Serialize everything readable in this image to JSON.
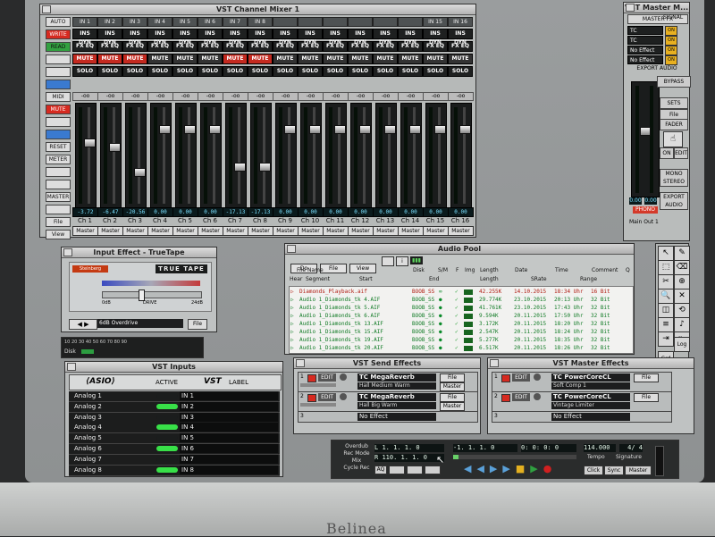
{
  "monitor": {
    "brand": "Belinea"
  },
  "mixer": {
    "title": "VST Channel Mixer 1",
    "controls": [
      "AUTO",
      "WRITE",
      "READ",
      "",
      "",
      "",
      "MIDI",
      "MUTE",
      "",
      "",
      "RESET",
      "METER",
      "",
      "",
      "MASTER",
      "",
      "File",
      "View"
    ],
    "channels": [
      {
        "in": "IN 1",
        "fx": "FX EQ",
        "ins": "INS DYN",
        "mute": "MUTE",
        "mute_on": true,
        "solo": "SOLO",
        "val": "-3.72",
        "name": "Ch 1",
        "out": "Master",
        "cap": 0.35
      },
      {
        "in": "IN 2",
        "fx": "FX EQ",
        "ins": "INS DYN",
        "mute": "MUTE",
        "mute_on": true,
        "solo": "SOLO",
        "val": "-6.47",
        "name": "Ch 2",
        "out": "Master",
        "cap": 0.4
      },
      {
        "in": "IN 3",
        "fx": "FX EQ",
        "ins": "INS DYN",
        "mute": "MUTE",
        "mute_on": true,
        "solo": "SOLO",
        "val": "-20.56",
        "name": "Ch 3",
        "out": "Master",
        "cap": 0.68
      },
      {
        "in": "IN 4",
        "fx": "FX EQ",
        "ins": "INS DYN",
        "mute": "MUTE",
        "mute_on": false,
        "solo": "SOLO",
        "val": "0.00",
        "name": "Ch 4",
        "out": "Master",
        "cap": 0.2
      },
      {
        "in": "IN 5",
        "fx": "FX EQ",
        "ins": "INS DYN",
        "mute": "MUTE",
        "mute_on": false,
        "solo": "SOLO",
        "val": "0.00",
        "name": "Ch 5",
        "out": "Master",
        "cap": 0.2
      },
      {
        "in": "IN 6",
        "fx": "FX EQ",
        "ins": "INS DYN",
        "mute": "MUTE",
        "mute_on": false,
        "solo": "SOLO",
        "val": "0.00",
        "name": "Ch 6",
        "out": "Master",
        "cap": 0.2
      },
      {
        "in": "IN 7",
        "fx": "FX EQ",
        "ins": "INS DYN",
        "mute": "MUTE",
        "mute_on": true,
        "solo": "SOLO",
        "val": "-17.13",
        "name": "Ch 7",
        "out": "Master",
        "cap": 0.62
      },
      {
        "in": "IN 8",
        "fx": "FX EQ",
        "ins": "INS DYN",
        "mute": "MUTE",
        "mute_on": true,
        "solo": "SOLO",
        "val": "-17.13",
        "name": "Ch 8",
        "out": "Master",
        "cap": 0.62
      },
      {
        "in": "",
        "fx": "FX EQ",
        "ins": "INS DYN",
        "mute": "MUTE",
        "mute_on": false,
        "solo": "SOLO",
        "val": "0.00",
        "name": "Ch 9",
        "out": "Master",
        "cap": 0.2
      },
      {
        "in": "",
        "fx": "FX EQ",
        "ins": "INS DYN",
        "mute": "MUTE",
        "mute_on": false,
        "solo": "SOLO",
        "val": "0.00",
        "name": "Ch 10",
        "out": "Master",
        "cap": 0.2
      },
      {
        "in": "",
        "fx": "FX EQ",
        "ins": "INS DYN",
        "mute": "MUTE",
        "mute_on": false,
        "solo": "SOLO",
        "val": "0.00",
        "name": "Ch 11",
        "out": "Master",
        "cap": 0.2
      },
      {
        "in": "",
        "fx": "FX EQ",
        "ins": "INS DYN",
        "mute": "MUTE",
        "mute_on": false,
        "solo": "SOLO",
        "val": "0.00",
        "name": "Ch 12",
        "out": "Master",
        "cap": 0.2
      },
      {
        "in": "",
        "fx": "FX EQ",
        "ins": "INS DYN",
        "mute": "MUTE",
        "mute_on": false,
        "solo": "SOLO",
        "val": "0.00",
        "name": "Ch 13",
        "out": "Master",
        "cap": 0.2
      },
      {
        "in": "",
        "fx": "FX EQ",
        "ins": "INS DYN",
        "mute": "MUTE",
        "mute_on": false,
        "solo": "SOLO",
        "val": "0.00",
        "name": "Ch 14",
        "out": "Master",
        "cap": 0.2
      },
      {
        "in": "IN 15",
        "fx": "FX EQ",
        "ins": "INS DYN",
        "mute": "MUTE",
        "mute_on": false,
        "solo": "SOLO",
        "val": "0.00",
        "name": "Ch 15",
        "out": "Master",
        "cap": 0.2
      },
      {
        "in": "IN 16",
        "fx": "FX EQ",
        "ins": "INS DYN",
        "mute": "MUTE",
        "mute_on": false,
        "solo": "SOLO",
        "val": "0.00",
        "name": "Ch 16",
        "out": "Master",
        "cap": 0.2
      }
    ]
  },
  "master": {
    "title": "VST Master M...",
    "fx_label": "MASTER FX",
    "signal_label": "SIGNAL",
    "slots": [
      "TC PowerCo..",
      "TC PowerCo..",
      "No Effect",
      "No Effect"
    ],
    "slot_state": [
      "ON",
      "ON",
      "ON",
      "ON"
    ],
    "export": "EXPORT AUDIO",
    "bypass": "BYPASS",
    "sets": "SETS",
    "file": "File",
    "fader": "FADER",
    "on": "ON",
    "edit": "EDIT",
    "mono_stereo": "MONO STEREO",
    "export_audio": "EXPORT AUDIO",
    "val_l": "0.00",
    "val_r": "0.00",
    "phono": "PHONO",
    "out": "Main Out 1"
  },
  "truetape": {
    "title": "Input Effect - TrueTape",
    "logo": "TRUE TAPE",
    "brand": "Steinberg",
    "label_l": "0dB",
    "label_c": "DRIVE",
    "label_r": "24dB",
    "preset": "6dB Overdrive",
    "file": "File"
  },
  "disk": {
    "label": "Disk",
    "scale": "10 20 30 40 50 60 70 80 90"
  },
  "pool": {
    "title": "Audio Pool",
    "menus": [
      "Do",
      "File",
      "View"
    ],
    "headers": {
      "file": "File Name",
      "disk": "Disk",
      "sm": "S/M",
      "f": "F",
      "img": "Img",
      "length": "Length",
      "date": "Date",
      "time": "Time",
      "comment": "Comment",
      "q": "Q"
    },
    "subheaders": {
      "hear": "Hear",
      "segment": "Segment",
      "start": "Start",
      "end": "End",
      "length": "Length",
      "srate": "SRate",
      "range": "Range"
    },
    "rows": [
      {
        "name": "Diamonds_Playback.aif",
        "disk": "BOOB_SS",
        "length": "42.255K",
        "date": "14.10.2015",
        "time": "18:34 Uhr",
        "comment": "16 Bit",
        "color": "#b01a10"
      },
      {
        "name": "Audio 1_Diamonds_tk 4.AIF",
        "disk": "BOOB_SS",
        "length": "29.774K",
        "date": "23.10.2015",
        "time": "20:13 Uhr",
        "comment": "32 Bit",
        "color": "#0f7a24"
      },
      {
        "name": "Audio 1_Diamonds_tk 5.AIF",
        "disk": "BOOB_SS",
        "length": "41.761K",
        "date": "23.10.2015",
        "time": "17:43 Uhr",
        "comment": "32 Bit",
        "color": "#0f7a24"
      },
      {
        "name": "Audio 1_Diamonds_tk 6.AIF",
        "disk": "BOOB_SS",
        "length": "9.594K",
        "date": "20.11.2015",
        "time": "17:50 Uhr",
        "comment": "32 Bit",
        "color": "#0f7a24"
      },
      {
        "name": "Audio 1_Diamonds_tk 13.AIF",
        "disk": "BOOB_SS",
        "length": "3.172K",
        "date": "20.11.2015",
        "time": "18:20 Uhr",
        "comment": "32 Bit",
        "color": "#0f7a24"
      },
      {
        "name": "Audio 1_Diamonds_tk 15.AIF",
        "disk": "BOOB_SS",
        "length": "2.547K",
        "date": "20.11.2015",
        "time": "18:24 Uhr",
        "comment": "32 Bit",
        "color": "#0f7a24"
      },
      {
        "name": "Audio 1_Diamonds_tk 19.AIF",
        "disk": "BOOB_SS",
        "length": "5.277K",
        "date": "20.11.2015",
        "time": "18:35 Uhr",
        "comment": "32 Bit",
        "color": "#0f7a24"
      },
      {
        "name": "Audio 1_Diamonds_tk 20.AIF",
        "disk": "BOOB_SS",
        "length": "6.517K",
        "date": "20.11.2015",
        "time": "18:26 Uhr",
        "comment": "32 Bit",
        "color": "#0f7a24"
      }
    ]
  },
  "toolbox": {
    "log": "Log",
    "grid": "Grd"
  },
  "inputs": {
    "title": "VST Inputs",
    "asio": "ASIO",
    "active": "ACTIVE",
    "label": "LABEL",
    "vst": "VST",
    "rows": [
      {
        "name": "Analog 1",
        "active": false,
        "in": "IN 1"
      },
      {
        "name": "Analog 2",
        "active": true,
        "in": "IN 2"
      },
      {
        "name": "Analog 3",
        "active": false,
        "in": "IN 3"
      },
      {
        "name": "Analog 4",
        "active": true,
        "in": "IN 4"
      },
      {
        "name": "Analog 5",
        "active": false,
        "in": "IN 5"
      },
      {
        "name": "Analog 6",
        "active": true,
        "in": "IN 6"
      },
      {
        "name": "Analog 7",
        "active": false,
        "in": "IN 7"
      },
      {
        "name": "Analog 8",
        "active": true,
        "in": "IN 8"
      }
    ]
  },
  "sendfx": {
    "title": "VST Send Effects",
    "slots": [
      {
        "n": "1",
        "edit": "EDIT",
        "name": "TC MegaReverb",
        "preset": "Hall Medium Warm",
        "file": "File",
        "out": "Master"
      },
      {
        "n": "2",
        "edit": "EDIT",
        "name": "TC MegaReverb",
        "preset": "Hall Big Warm",
        "file": "File",
        "out": "Master"
      },
      {
        "n": "3",
        "name": "No Effect"
      }
    ]
  },
  "masterfx": {
    "title": "VST Master Effects",
    "slots": [
      {
        "n": "1",
        "edit": "EDIT",
        "name": "TC PowerCoreCL",
        "preset": "Soft Comp 1",
        "file": "File"
      },
      {
        "n": "2",
        "edit": "EDIT",
        "name": "TC PowerCoreCL",
        "preset": "Vintage Limiter",
        "file": "File"
      },
      {
        "n": "3",
        "name": "No Effect"
      }
    ]
  },
  "transport": {
    "overdub": "Overdub",
    "recmode": "Rec Mode",
    "mix": "Mix",
    "cycle": "Cycle Rec",
    "l": "L",
    "r": "R",
    "lpos": "1. 1. 1.     0",
    "rpos": "110. 1. 1.     0",
    "ac": "AQ",
    "pos1": "-1. 1. 1.    0",
    "pos2": "0:  0:  0:  0",
    "tempo": "114.000",
    "sig": "4/ 4",
    "tempo_lbl": "Tempo",
    "sig_lbl": "Signature",
    "click": "Click",
    "sync": "Sync",
    "master": "Master"
  }
}
